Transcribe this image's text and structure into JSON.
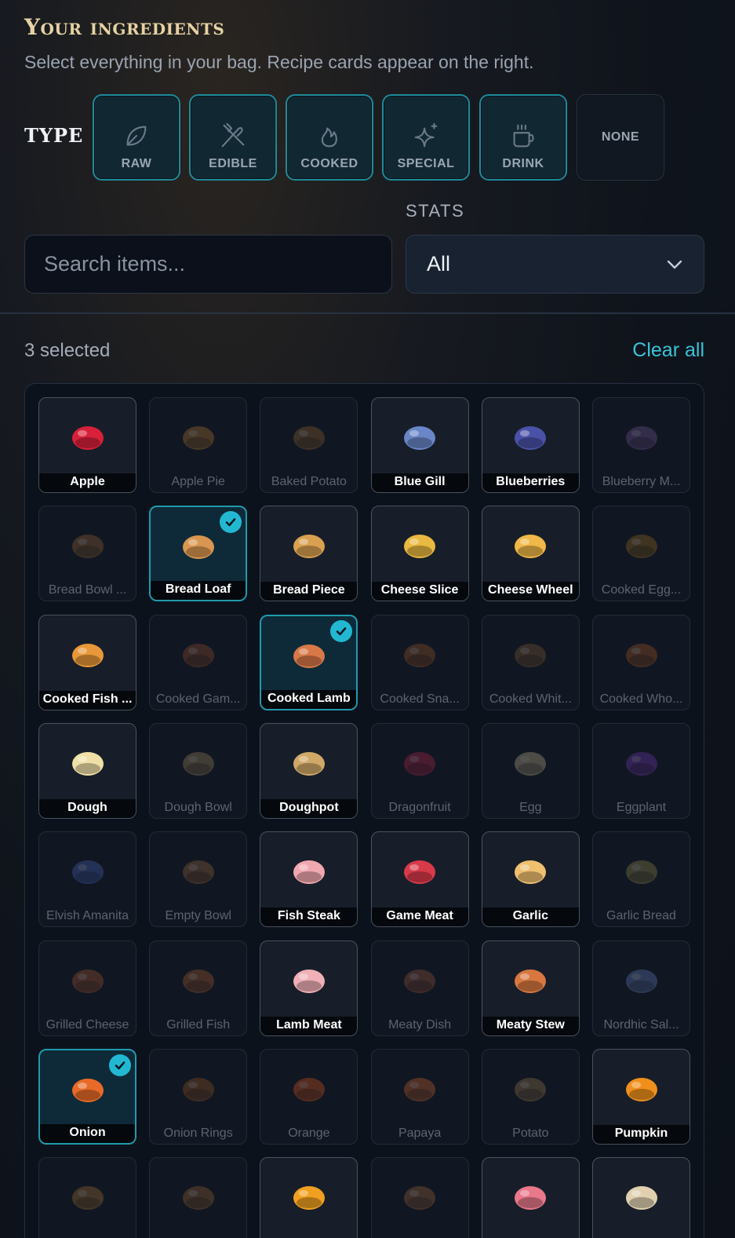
{
  "header": {
    "title": "Your ingredients",
    "subtitle": "Select everything in your bag. Recipe cards appear on the right."
  },
  "filters": {
    "type_label": "TYPE",
    "types": [
      {
        "label": "RAW",
        "icon": "leaf-icon",
        "active": true
      },
      {
        "label": "EDIBLE",
        "icon": "fork-knife-icon",
        "active": true
      },
      {
        "label": "COOKED",
        "icon": "flame-icon",
        "active": true
      },
      {
        "label": "SPECIAL",
        "icon": "sparkle-icon",
        "active": true
      },
      {
        "label": "DRINK",
        "icon": "mug-icon",
        "active": true
      },
      {
        "label": "NONE",
        "icon": "",
        "active": false
      }
    ],
    "stats_label": "STATS",
    "search_placeholder": "Search items...",
    "stats_value": "All"
  },
  "selection": {
    "count_text": "3 selected",
    "clear_label": "Clear all"
  },
  "colors": {
    "accent": "#22b8d2",
    "title_gold": "#e6d3a3",
    "background": "#0f141c"
  },
  "items": [
    {
      "name": "Apple",
      "state": "avail",
      "color": "#d8203a"
    },
    {
      "name": "Apple Pie",
      "state": "dim",
      "color": "#b87a30"
    },
    {
      "name": "Baked Potato",
      "state": "dim",
      "color": "#9a6a34"
    },
    {
      "name": "Blue Gill",
      "state": "avail",
      "color": "#6a86c8"
    },
    {
      "name": "Blueberries",
      "state": "avail",
      "color": "#4a52a8"
    },
    {
      "name": "Blueberry M...",
      "state": "dim",
      "color": "#7a5aa0"
    },
    {
      "name": "Bread Bowl ...",
      "state": "dim",
      "color": "#a06a38"
    },
    {
      "name": "Bread Loaf",
      "state": "sel",
      "color": "#d89650"
    },
    {
      "name": "Bread Piece",
      "state": "avail",
      "color": "#d8a050"
    },
    {
      "name": "Cheese Slice",
      "state": "avail",
      "color": "#e8b840"
    },
    {
      "name": "Cheese Wheel",
      "state": "avail",
      "color": "#f0b848"
    },
    {
      "name": "Cooked Egg...",
      "state": "dim",
      "color": "#a07020"
    },
    {
      "name": "Cooked Fish ...",
      "state": "avail",
      "color": "#e89838"
    },
    {
      "name": "Cooked Gam...",
      "state": "dim",
      "color": "#9a5030"
    },
    {
      "name": "Cooked Lamb",
      "state": "sel",
      "color": "#d87848"
    },
    {
      "name": "Cooked Sna...",
      "state": "dim",
      "color": "#a05828"
    },
    {
      "name": "Cooked Whit...",
      "state": "dim",
      "color": "#8a6038"
    },
    {
      "name": "Cooked Who...",
      "state": "dim",
      "color": "#b05a28"
    },
    {
      "name": "Dough",
      "state": "avail",
      "color": "#f0e0a8"
    },
    {
      "name": "Dough Bowl",
      "state": "dim",
      "color": "#a88a60"
    },
    {
      "name": "Doughpot",
      "state": "avail",
      "color": "#d0a868"
    },
    {
      "name": "Dragonfruit",
      "state": "dim",
      "color": "#c02850"
    },
    {
      "name": "Egg",
      "state": "dim",
      "color": "#c8b890"
    },
    {
      "name": "Eggplant",
      "state": "dim",
      "color": "#7a3ac0"
    },
    {
      "name": "Elvish Amanita",
      "state": "dim",
      "color": "#4a6ac8"
    },
    {
      "name": "Empty Bowl",
      "state": "dim",
      "color": "#a06840"
    },
    {
      "name": "Fish Steak",
      "state": "avail",
      "color": "#f0a8b0"
    },
    {
      "name": "Game Meat",
      "state": "avail",
      "color": "#d83a4a"
    },
    {
      "name": "Garlic",
      "state": "avail",
      "color": "#f0c070"
    },
    {
      "name": "Garlic Bread",
      "state": "dim",
      "color": "#9a9050"
    },
    {
      "name": "Grilled Cheese",
      "state": "dim",
      "color": "#b05a30"
    },
    {
      "name": "Grilled Fish",
      "state": "dim",
      "color": "#b06030"
    },
    {
      "name": "Lamb Meat",
      "state": "avail",
      "color": "#f0b0b8"
    },
    {
      "name": "Meaty Dish",
      "state": "dim",
      "color": "#a05840"
    },
    {
      "name": "Meaty Stew",
      "state": "avail",
      "color": "#d87840"
    },
    {
      "name": "Nordhic Sal...",
      "state": "dim",
      "color": "#6a86c8"
    },
    {
      "name": "Onion",
      "state": "sel",
      "color": "#e86a28"
    },
    {
      "name": "Onion Rings",
      "state": "dim",
      "color": "#a05a28"
    },
    {
      "name": "Orange",
      "state": "dim",
      "color": "#e85a20"
    },
    {
      "name": "Papaya",
      "state": "dim",
      "color": "#d86a30"
    },
    {
      "name": "Potato",
      "state": "dim",
      "color": "#a08050"
    },
    {
      "name": "Pumpkin",
      "state": "avail",
      "color": "#f0901c"
    },
    {
      "name": "",
      "state": "dim",
      "color": "#b07838"
    },
    {
      "name": "",
      "state": "dim",
      "color": "#a06838"
    },
    {
      "name": "",
      "state": "avail",
      "color": "#f0a020"
    },
    {
      "name": "",
      "state": "dim",
      "color": "#a86a40"
    },
    {
      "name": "",
      "state": "avail",
      "color": "#e8788a"
    },
    {
      "name": "",
      "state": "avail",
      "color": "#e0d0b0"
    }
  ]
}
